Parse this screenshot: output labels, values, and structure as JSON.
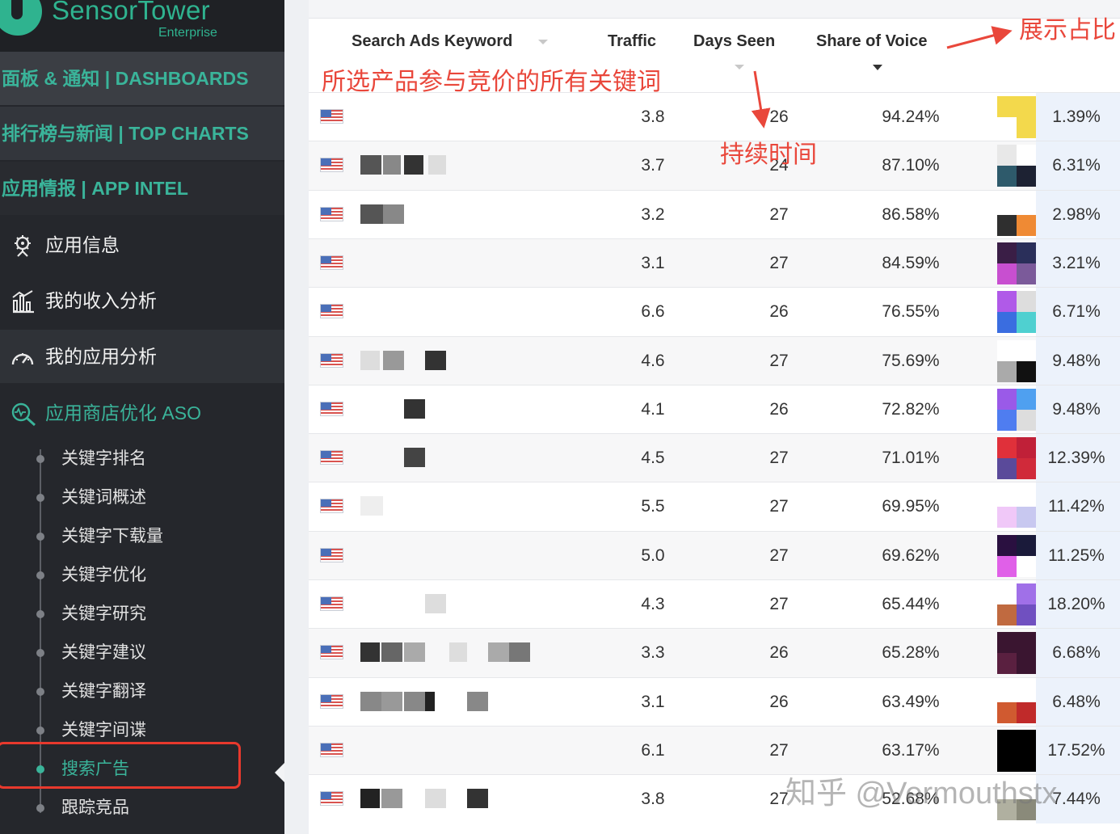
{
  "brand": {
    "name": "SensorTower",
    "edition": "Enterprise"
  },
  "sidebar": {
    "top_items": [
      {
        "label": "面板 & 通知 | DASHBOARDS"
      },
      {
        "label": "排行榜与新闻 | TOP CHARTS"
      },
      {
        "label": "应用情报 | APP INTEL"
      }
    ],
    "app_items": [
      {
        "label": "应用信息",
        "icon": "app-info-icon"
      },
      {
        "label": "我的收入分析",
        "icon": "revenue-chart-icon"
      },
      {
        "label": "我的应用分析",
        "icon": "speedometer-icon"
      }
    ],
    "aso": {
      "label": "应用商店优化 ASO",
      "icon": "aso-magnifier-icon"
    },
    "sub_items": [
      {
        "label": "关键字排名"
      },
      {
        "label": "关键词概述"
      },
      {
        "label": "关键字下载量"
      },
      {
        "label": "关键字优化"
      },
      {
        "label": "关键字研究"
      },
      {
        "label": "关键字建议"
      },
      {
        "label": "关键字翻译"
      },
      {
        "label": "关键字间谍"
      },
      {
        "label": "搜索广告",
        "active": true
      },
      {
        "label": "跟踪竞品"
      }
    ]
  },
  "table": {
    "headers": {
      "keyword": "Search Ads Keyword",
      "traffic": "Traffic",
      "days_seen": "Days Seen",
      "share_of_voice": "Share of Voice"
    },
    "rows": [
      {
        "traffic": "3.8",
        "days": "26",
        "sov": "94.24%",
        "share": "1.39%"
      },
      {
        "traffic": "3.7",
        "days": "24",
        "sov": "87.10%",
        "share": "6.31%"
      },
      {
        "traffic": "3.2",
        "days": "27",
        "sov": "86.58%",
        "share": "2.98%"
      },
      {
        "traffic": "3.1",
        "days": "27",
        "sov": "84.59%",
        "share": "3.21%"
      },
      {
        "traffic": "6.6",
        "days": "26",
        "sov": "76.55%",
        "share": "6.71%"
      },
      {
        "traffic": "4.6",
        "days": "27",
        "sov": "75.69%",
        "share": "9.48%"
      },
      {
        "traffic": "4.1",
        "days": "26",
        "sov": "72.82%",
        "share": "9.48%"
      },
      {
        "traffic": "4.5",
        "days": "27",
        "sov": "71.01%",
        "share": "12.39%"
      },
      {
        "traffic": "5.5",
        "days": "27",
        "sov": "69.95%",
        "share": "11.42%"
      },
      {
        "traffic": "5.0",
        "days": "27",
        "sov": "69.62%",
        "share": "11.25%"
      },
      {
        "traffic": "4.3",
        "days": "27",
        "sov": "65.44%",
        "share": "18.20%"
      },
      {
        "traffic": "3.3",
        "days": "26",
        "sov": "65.28%",
        "share": "6.68%"
      },
      {
        "traffic": "3.1",
        "days": "26",
        "sov": "63.49%",
        "share": "6.48%"
      },
      {
        "traffic": "6.1",
        "days": "27",
        "sov": "63.17%",
        "share": "17.52%"
      },
      {
        "traffic": "3.8",
        "days": "27",
        "sov": "52.68%",
        "share": "7.44%"
      }
    ]
  },
  "annotations": {
    "keywords_note": "所选产品参与竞价的所有关键词",
    "duration_note": "持续时间",
    "share_note": "展示占比"
  },
  "watermark": "知乎 @Vermouthstx",
  "colors": {
    "accent": "#3ab49a",
    "sidebar_bg": "#25272c",
    "annotation_red": "#e9473b",
    "highlight_box": "#e8392d"
  }
}
